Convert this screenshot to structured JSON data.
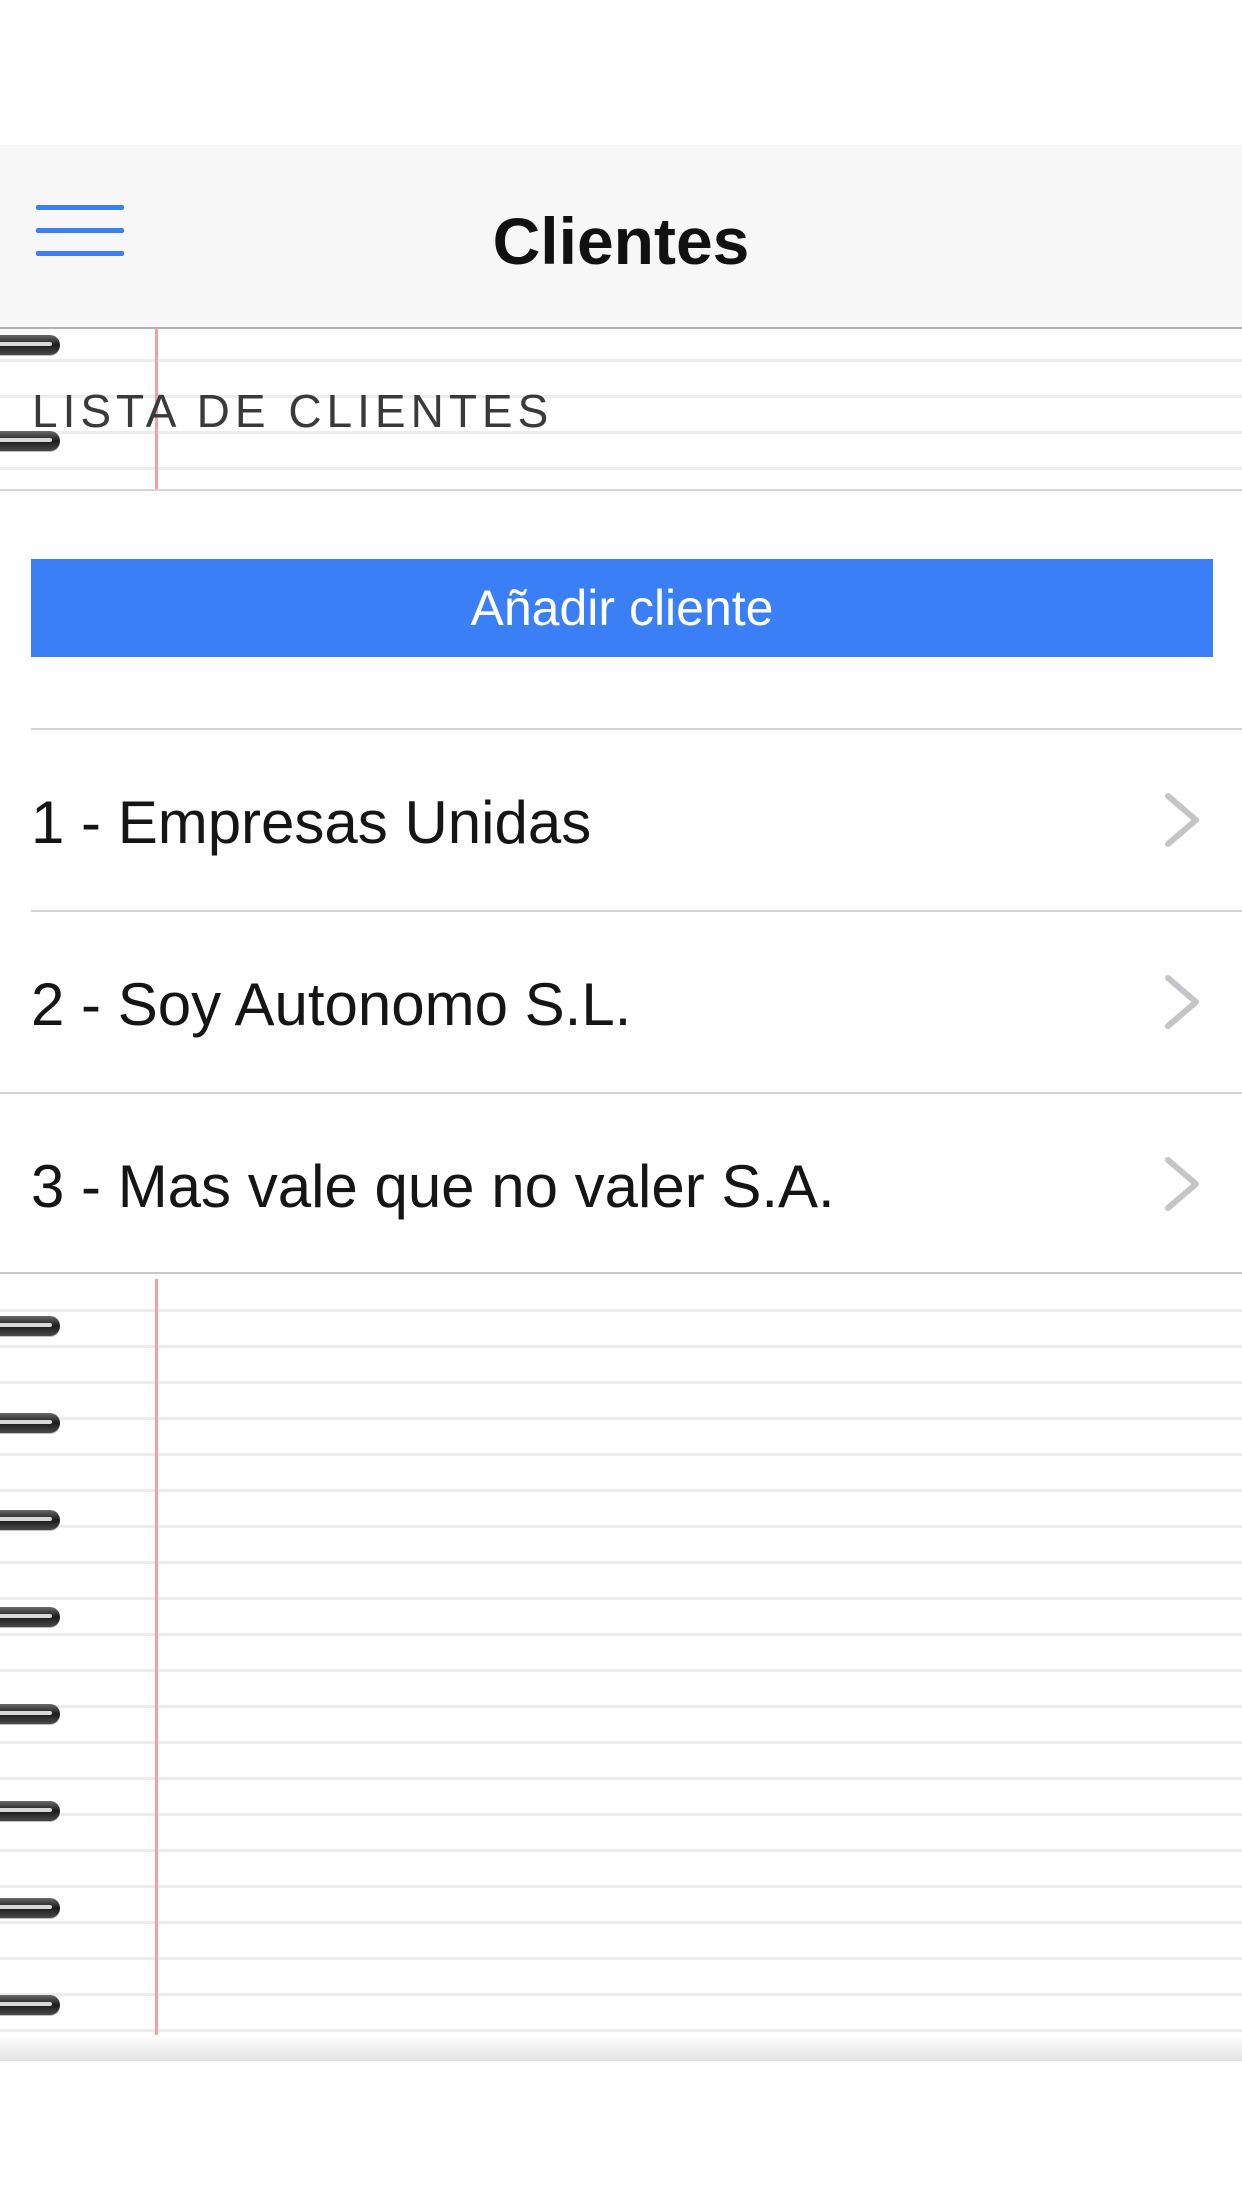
{
  "navbar": {
    "title": "Clientes",
    "menu_icon": "hamburger-menu-icon",
    "accent_color": "#3b7ff6"
  },
  "section": {
    "header": "LISTA DE CLIENTES"
  },
  "actions": {
    "add_client_label": "Añadir cliente"
  },
  "clients": [
    {
      "label": "1 - Empresas Unidas",
      "icon": "chevron-right-icon"
    },
    {
      "label": "2 - Soy Autonomo S.L.",
      "icon": "chevron-right-icon"
    },
    {
      "label": "3 - Mas vale que no valer S.A.",
      "icon": "chevron-right-icon"
    }
  ],
  "background": {
    "style": "notebook-paper",
    "margin_line_color": "#f3a0a0"
  }
}
